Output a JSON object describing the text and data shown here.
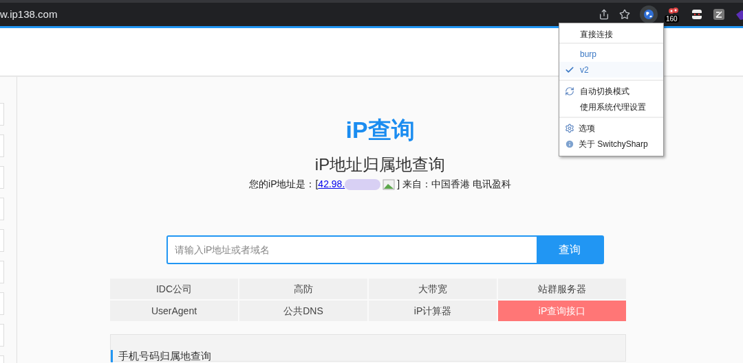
{
  "address_bar": {
    "url": "w.ip138.com"
  },
  "toolbar": {
    "badge": "160"
  },
  "proxy_menu": {
    "groups": [
      [
        {
          "kind": "plain",
          "label": "直接连接"
        }
      ],
      [
        {
          "kind": "profile",
          "label": "burp",
          "selected": false
        },
        {
          "kind": "profile",
          "label": "v2",
          "selected": true
        }
      ],
      [
        {
          "kind": "auto",
          "label": "自动切换模式"
        },
        {
          "kind": "plain",
          "label": "使用系统代理设置"
        }
      ],
      [
        {
          "kind": "options",
          "label": "选项"
        },
        {
          "kind": "about",
          "label": "关于 SwitchySharp"
        }
      ]
    ]
  },
  "logo": {
    "lead": "iP",
    "rest": "查询"
  },
  "heading": "iP地址归属地查询",
  "ip_line": {
    "prefix": "您的iP地址是：[",
    "link": "42.98.",
    "suffix": "] 来自：中国香港 电讯盈科"
  },
  "search": {
    "placeholder": "请输入iP地址或者域名",
    "button": "查询"
  },
  "links": [
    {
      "label": "IDC公司",
      "highlighted": false
    },
    {
      "label": "高防",
      "highlighted": false
    },
    {
      "label": "大带宽",
      "highlighted": false
    },
    {
      "label": "站群服务器",
      "highlighted": false
    },
    {
      "label": "UserAgent",
      "highlighted": false
    },
    {
      "label": "公共DNS",
      "highlighted": false
    },
    {
      "label": "iP计算器",
      "highlighted": false
    },
    {
      "label": "iP查询接口",
      "highlighted": true
    }
  ],
  "section": {
    "title": "手机号码归属地查询"
  }
}
